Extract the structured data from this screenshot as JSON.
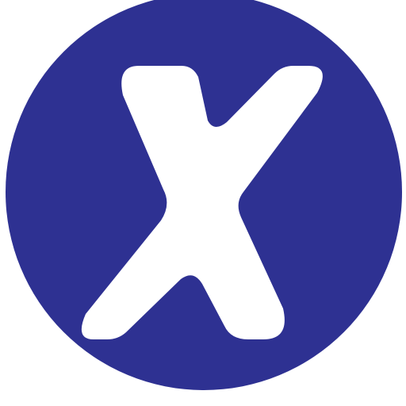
{
  "logo": {
    "icon": "x-mark-icon",
    "glyph": "X",
    "colors": {
      "circle": "#2e3192",
      "mark": "#ffffff",
      "background": "#ffffff"
    }
  }
}
